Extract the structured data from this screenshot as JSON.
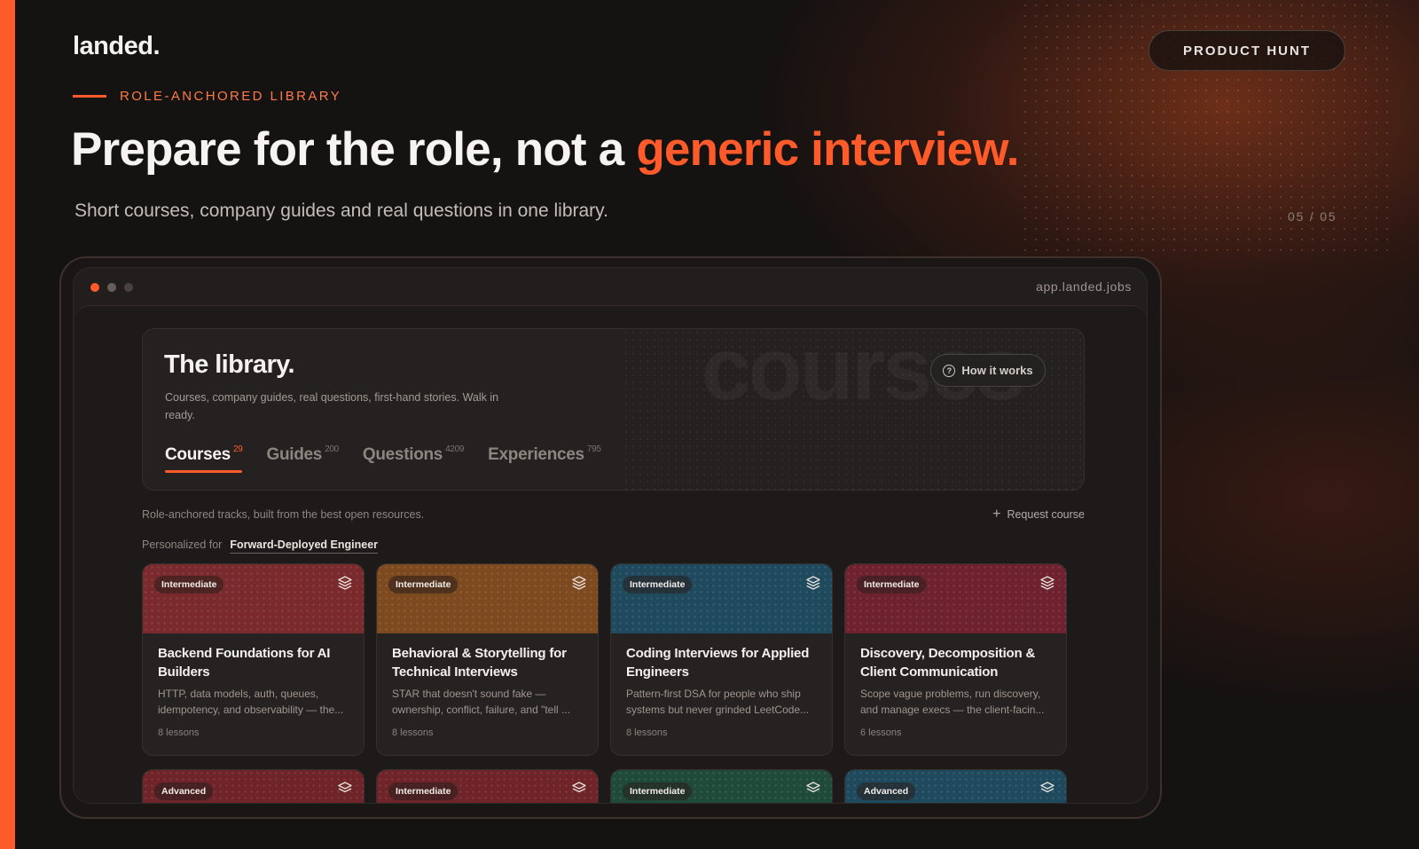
{
  "brand": {
    "logo": "landed."
  },
  "header": {
    "product_hunt": "PRODUCT HUNT",
    "eyebrow": "ROLE-ANCHORED LIBRARY",
    "headline_main": "Prepare for the role, not a ",
    "headline_accent": "generic interview.",
    "subhead": "Short courses, company guides and real questions in one library.",
    "page_count": "05 / 05"
  },
  "colors": {
    "accent": "#ff5a2a",
    "background": "#151212"
  },
  "window": {
    "url": "app.landed.jobs"
  },
  "library": {
    "title": "The library.",
    "description": "Courses, company guides, real questions, first-hand stories. Walk in ready.",
    "watermark": "courses",
    "how_it_works": "How it works",
    "tabs": [
      {
        "label": "Courses",
        "count": "29"
      },
      {
        "label": "Guides",
        "count": "200"
      },
      {
        "label": "Questions",
        "count": "4209"
      },
      {
        "label": "Experiences",
        "count": "795"
      }
    ]
  },
  "tracks": {
    "description": "Role-anchored tracks, built from the best open resources.",
    "request_course": "Request course",
    "personalized_label": "Personalized for",
    "role": "Forward-Deployed Engineer"
  },
  "courses": [
    {
      "level": "Intermediate",
      "title": "Backend Foundations for AI Builders",
      "description": "HTTP, data models, auth, queues, idempotency, and observability — the...",
      "lessons": "8 lessons",
      "color": "#7a2a2c",
      "icon": "layers-icon"
    },
    {
      "level": "Intermediate",
      "title": "Behavioral & Storytelling for Technical Interviews",
      "description": "STAR that doesn't sound fake — ownership, conflict, failure, and \"tell ...",
      "lessons": "8 lessons",
      "color": "#7d4a1f",
      "icon": "layers-icon"
    },
    {
      "level": "Intermediate",
      "title": "Coding Interviews for Applied Engineers",
      "description": "Pattern-first DSA for people who ship systems but never grinded LeetCode...",
      "lessons": "8 lessons",
      "color": "#1f4a5e",
      "icon": "layers-icon"
    },
    {
      "level": "Intermediate",
      "title": "Discovery, Decomposition & Client Communication",
      "description": "Scope vague problems, run discovery, and manage execs — the client-facin...",
      "lessons": "6 lessons",
      "color": "#6e2230",
      "icon": "layers-icon"
    }
  ],
  "courses_row2": [
    {
      "level": "Advanced",
      "color": "#6e2428"
    },
    {
      "level": "Intermediate",
      "color": "#6e2428"
    },
    {
      "level": "Intermediate",
      "color": "#1f4a3a"
    },
    {
      "level": "Advanced",
      "color": "#1f4a5e"
    }
  ]
}
